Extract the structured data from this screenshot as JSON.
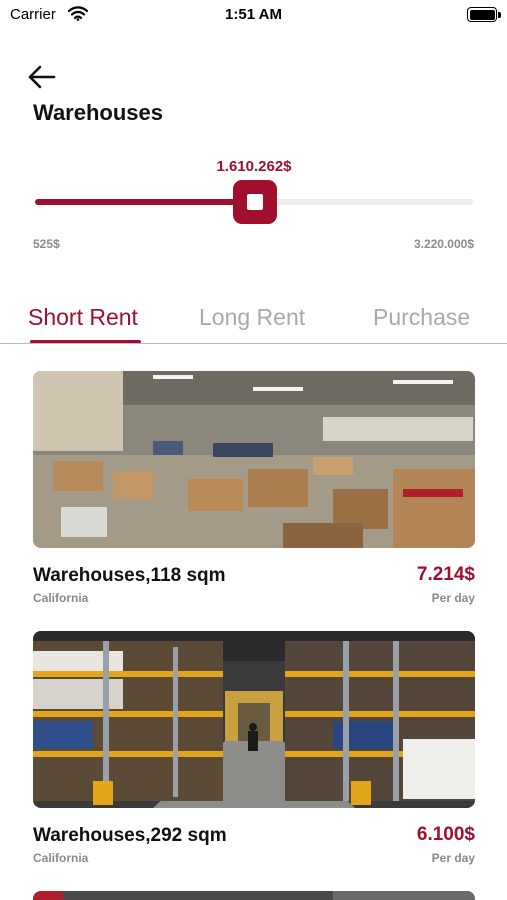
{
  "status_bar": {
    "carrier": "Carrier",
    "time": "1:51 AM"
  },
  "header": {
    "title": "Warehouses"
  },
  "price_slider": {
    "current_label": "1.610.262$",
    "min_label": "525$",
    "max_label": "3.220.000$",
    "position_fraction": 0.5,
    "accent_color": "#a0102e"
  },
  "tabs": [
    {
      "label": "Short Rent",
      "active": true
    },
    {
      "label": "Long Rent",
      "active": false
    },
    {
      "label": "Purchase",
      "active": false
    }
  ],
  "listings": [
    {
      "title": "Warehouses,118 sqm",
      "location": "California",
      "price": "7.214$",
      "unit": "Per day"
    },
    {
      "title": "Warehouses,292 sqm",
      "location": "California",
      "price": "6.100$",
      "unit": "Per day"
    }
  ],
  "icons": {
    "back": "arrow-left-icon",
    "wifi": "wifi-icon",
    "battery": "battery-icon"
  }
}
